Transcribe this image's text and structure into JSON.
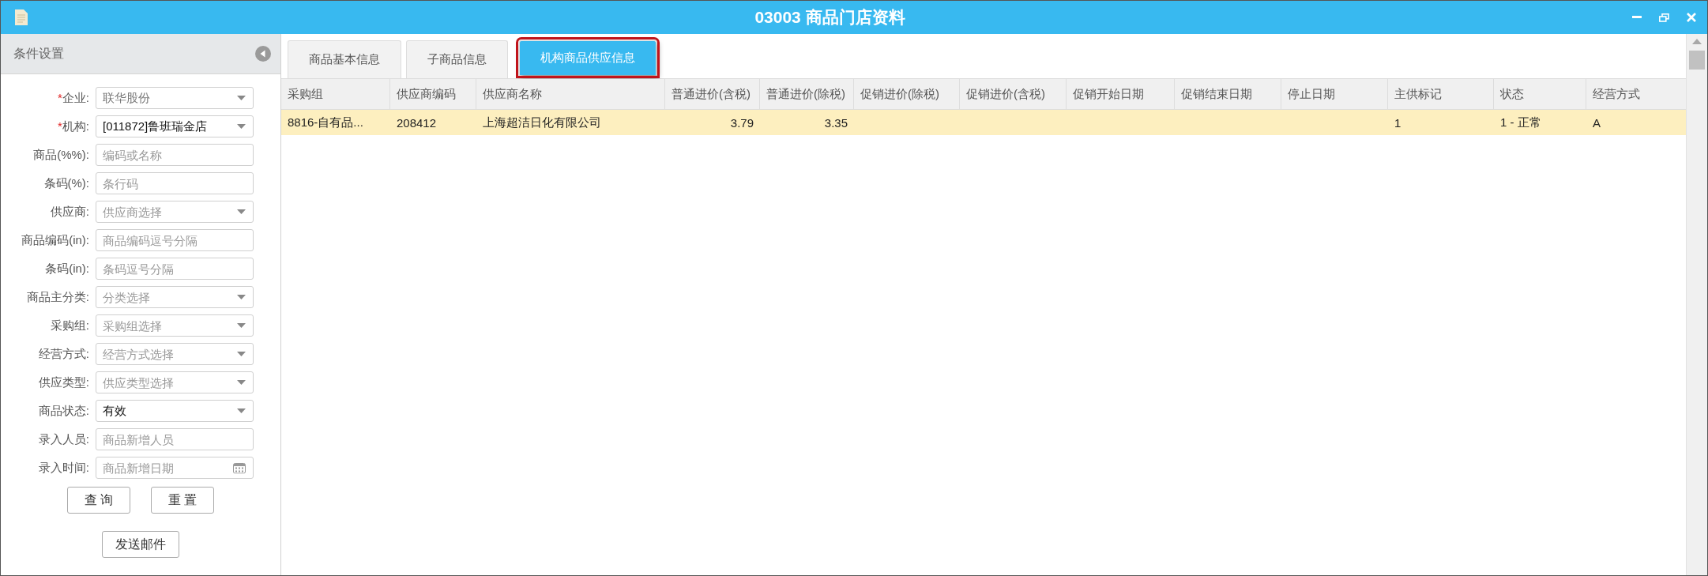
{
  "window": {
    "title": "03003 商品门店资料"
  },
  "sidebar": {
    "title": "条件设置",
    "fields": [
      {
        "label": "企业:",
        "required_mark": "*",
        "kind": "select",
        "value": "联华股份",
        "disabled": true
      },
      {
        "label": "机构:",
        "required_mark": "*",
        "kind": "select",
        "value": "[011872]鲁班瑞金店",
        "disabled": false
      },
      {
        "label": "商品(%%):",
        "kind": "input",
        "placeholder": "编码或名称"
      },
      {
        "label": "条码(%):",
        "kind": "input",
        "placeholder": "条行码"
      },
      {
        "label": "供应商:",
        "kind": "select",
        "placeholder": "供应商选择"
      },
      {
        "label": "商品编码(in):",
        "kind": "input",
        "placeholder": "商品编码逗号分隔"
      },
      {
        "label": "条码(in):",
        "kind": "input",
        "placeholder": "条码逗号分隔"
      },
      {
        "label": "商品主分类:",
        "kind": "select",
        "placeholder": "分类选择"
      },
      {
        "label": "采购组:",
        "kind": "select",
        "placeholder": "采购组选择"
      },
      {
        "label": "经营方式:",
        "kind": "select",
        "placeholder": "经营方式选择"
      },
      {
        "label": "供应类型:",
        "kind": "select",
        "placeholder": "供应类型选择"
      },
      {
        "label": "商品状态:",
        "kind": "select",
        "value": "有效",
        "disabled": false
      },
      {
        "label": "录入人员:",
        "kind": "input",
        "placeholder": "商品新增人员"
      },
      {
        "label": "录入时间:",
        "kind": "date",
        "placeholder": "商品新增日期"
      }
    ],
    "buttons": [
      "查 询",
      "重 置"
    ],
    "mail_button": "发送邮件"
  },
  "tabs": [
    {
      "label": "商品基本信息",
      "selected": false
    },
    {
      "label": "子商品信息",
      "selected": false
    },
    {
      "label": "机构商品供应信息",
      "selected": true
    }
  ],
  "table": {
    "columns": [
      {
        "label": "采购组",
        "kind": "text"
      },
      {
        "label": "供应商编码",
        "kind": "text"
      },
      {
        "label": "供应商名称",
        "kind": "text"
      },
      {
        "label": "普通进价(含税)",
        "kind": "number"
      },
      {
        "label": "普通进价(除税)",
        "kind": "number"
      },
      {
        "label": "促销进价(除税)",
        "kind": "number"
      },
      {
        "label": "促销进价(含税)",
        "kind": "number"
      },
      {
        "label": "促销开始日期",
        "kind": "text"
      },
      {
        "label": "促销结束日期",
        "kind": "text"
      },
      {
        "label": "停止日期",
        "kind": "text"
      },
      {
        "label": "主供标记",
        "kind": "text"
      },
      {
        "label": "状态",
        "kind": "text"
      },
      {
        "label": "经营方式",
        "kind": "text"
      }
    ],
    "rows": [
      {
        "selected": true,
        "cells": [
          "8816-自有品...",
          "208412",
          "上海超洁日化有限公司",
          "3.79",
          "3.35",
          "",
          "",
          "",
          "",
          "",
          "1",
          "1 - 正常",
          "A"
        ]
      }
    ]
  }
}
